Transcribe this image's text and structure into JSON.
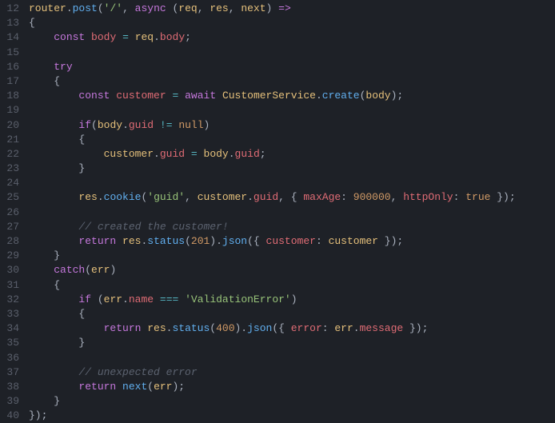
{
  "gutter": {
    "start": 12,
    "end": 40
  },
  "code": {
    "l12": [
      [
        "obj",
        "router"
      ],
      [
        "pun",
        "."
      ],
      [
        "fn",
        "post"
      ],
      [
        "pun",
        "("
      ],
      [
        "str",
        "'/'"
      ],
      [
        "pun",
        ", "
      ],
      [
        "kw",
        "async"
      ],
      [
        "pun",
        " ("
      ],
      [
        "obj",
        "req"
      ],
      [
        "pun",
        ", "
      ],
      [
        "obj",
        "res"
      ],
      [
        "pun",
        ", "
      ],
      [
        "obj",
        "next"
      ],
      [
        "pun",
        ") "
      ],
      [
        "kw",
        "=>"
      ]
    ],
    "l13": [
      [
        "pun",
        "{"
      ]
    ],
    "l14": [
      [
        "def",
        "    "
      ],
      [
        "kw",
        "const"
      ],
      [
        "def",
        " "
      ],
      [
        "var",
        "body"
      ],
      [
        "def",
        " "
      ],
      [
        "op",
        "="
      ],
      [
        "def",
        " "
      ],
      [
        "obj",
        "req"
      ],
      [
        "pun",
        "."
      ],
      [
        "prop",
        "body"
      ],
      [
        "pun",
        ";"
      ]
    ],
    "l15": [],
    "l16": [
      [
        "def",
        "    "
      ],
      [
        "kw",
        "try"
      ]
    ],
    "l17": [
      [
        "def",
        "    "
      ],
      [
        "pun",
        "{"
      ]
    ],
    "l18": [
      [
        "def",
        "        "
      ],
      [
        "kw",
        "const"
      ],
      [
        "def",
        " "
      ],
      [
        "var",
        "customer"
      ],
      [
        "def",
        " "
      ],
      [
        "op",
        "="
      ],
      [
        "def",
        " "
      ],
      [
        "kw",
        "await"
      ],
      [
        "def",
        " "
      ],
      [
        "obj",
        "CustomerService"
      ],
      [
        "pun",
        "."
      ],
      [
        "fn",
        "create"
      ],
      [
        "pun",
        "("
      ],
      [
        "obj",
        "body"
      ],
      [
        "pun",
        ");"
      ]
    ],
    "l19": [],
    "l20": [
      [
        "def",
        "        "
      ],
      [
        "kw",
        "if"
      ],
      [
        "pun",
        "("
      ],
      [
        "obj",
        "body"
      ],
      [
        "pun",
        "."
      ],
      [
        "prop",
        "guid"
      ],
      [
        "def",
        " "
      ],
      [
        "op",
        "!="
      ],
      [
        "def",
        " "
      ],
      [
        "bool",
        "null"
      ],
      [
        "pun",
        ")"
      ]
    ],
    "l21": [
      [
        "def",
        "        "
      ],
      [
        "pun",
        "{"
      ]
    ],
    "l22": [
      [
        "def",
        "            "
      ],
      [
        "obj",
        "customer"
      ],
      [
        "pun",
        "."
      ],
      [
        "prop",
        "guid"
      ],
      [
        "def",
        " "
      ],
      [
        "op",
        "="
      ],
      [
        "def",
        " "
      ],
      [
        "obj",
        "body"
      ],
      [
        "pun",
        "."
      ],
      [
        "prop",
        "guid"
      ],
      [
        "pun",
        ";"
      ]
    ],
    "l23": [
      [
        "def",
        "        "
      ],
      [
        "pun",
        "}"
      ]
    ],
    "l24": [],
    "l25": [
      [
        "def",
        "        "
      ],
      [
        "obj",
        "res"
      ],
      [
        "pun",
        "."
      ],
      [
        "fn",
        "cookie"
      ],
      [
        "pun",
        "("
      ],
      [
        "str",
        "'guid'"
      ],
      [
        "pun",
        ", "
      ],
      [
        "obj",
        "customer"
      ],
      [
        "pun",
        "."
      ],
      [
        "prop",
        "guid"
      ],
      [
        "pun",
        ", { "
      ],
      [
        "var",
        "maxAge"
      ],
      [
        "pun",
        ": "
      ],
      [
        "num",
        "900000"
      ],
      [
        "pun",
        ", "
      ],
      [
        "var",
        "httpOnly"
      ],
      [
        "pun",
        ": "
      ],
      [
        "bool",
        "true"
      ],
      [
        "pun",
        " });"
      ]
    ],
    "l26": [],
    "l27": [
      [
        "def",
        "        "
      ],
      [
        "cmt",
        "// created the customer!"
      ]
    ],
    "l28": [
      [
        "def",
        "        "
      ],
      [
        "kw",
        "return"
      ],
      [
        "def",
        " "
      ],
      [
        "obj",
        "res"
      ],
      [
        "pun",
        "."
      ],
      [
        "fn",
        "status"
      ],
      [
        "pun",
        "("
      ],
      [
        "num",
        "201"
      ],
      [
        "pun",
        ")."
      ],
      [
        "fn",
        "json"
      ],
      [
        "pun",
        "({ "
      ],
      [
        "var",
        "customer"
      ],
      [
        "pun",
        ": "
      ],
      [
        "obj",
        "customer"
      ],
      [
        "pun",
        " });"
      ]
    ],
    "l29": [
      [
        "def",
        "    "
      ],
      [
        "pun",
        "}"
      ]
    ],
    "l30": [
      [
        "def",
        "    "
      ],
      [
        "kw",
        "catch"
      ],
      [
        "pun",
        "("
      ],
      [
        "obj",
        "err"
      ],
      [
        "pun",
        ")"
      ]
    ],
    "l31": [
      [
        "def",
        "    "
      ],
      [
        "pun",
        "{"
      ]
    ],
    "l32": [
      [
        "def",
        "        "
      ],
      [
        "kw",
        "if"
      ],
      [
        "pun",
        " ("
      ],
      [
        "obj",
        "err"
      ],
      [
        "pun",
        "."
      ],
      [
        "prop",
        "name"
      ],
      [
        "def",
        " "
      ],
      [
        "op",
        "==="
      ],
      [
        "def",
        " "
      ],
      [
        "str",
        "'ValidationError'"
      ],
      [
        "pun",
        ")"
      ]
    ],
    "l33": [
      [
        "def",
        "        "
      ],
      [
        "pun",
        "{"
      ]
    ],
    "l34": [
      [
        "def",
        "            "
      ],
      [
        "kw",
        "return"
      ],
      [
        "def",
        " "
      ],
      [
        "obj",
        "res"
      ],
      [
        "pun",
        "."
      ],
      [
        "fn",
        "status"
      ],
      [
        "pun",
        "("
      ],
      [
        "num",
        "400"
      ],
      [
        "pun",
        ")."
      ],
      [
        "fn",
        "json"
      ],
      [
        "pun",
        "({ "
      ],
      [
        "var",
        "error"
      ],
      [
        "pun",
        ": "
      ],
      [
        "obj",
        "err"
      ],
      [
        "pun",
        "."
      ],
      [
        "prop",
        "message"
      ],
      [
        "pun",
        " });"
      ]
    ],
    "l35": [
      [
        "def",
        "        "
      ],
      [
        "pun",
        "}"
      ]
    ],
    "l36": [],
    "l37": [
      [
        "def",
        "        "
      ],
      [
        "cmt",
        "// unexpected error"
      ]
    ],
    "l38": [
      [
        "def",
        "        "
      ],
      [
        "kw",
        "return"
      ],
      [
        "def",
        " "
      ],
      [
        "fn",
        "next"
      ],
      [
        "pun",
        "("
      ],
      [
        "obj",
        "err"
      ],
      [
        "pun",
        ");"
      ]
    ],
    "l39": [
      [
        "def",
        "    "
      ],
      [
        "pun",
        "}"
      ]
    ],
    "l40": [
      [
        "pun",
        "});"
      ]
    ]
  }
}
